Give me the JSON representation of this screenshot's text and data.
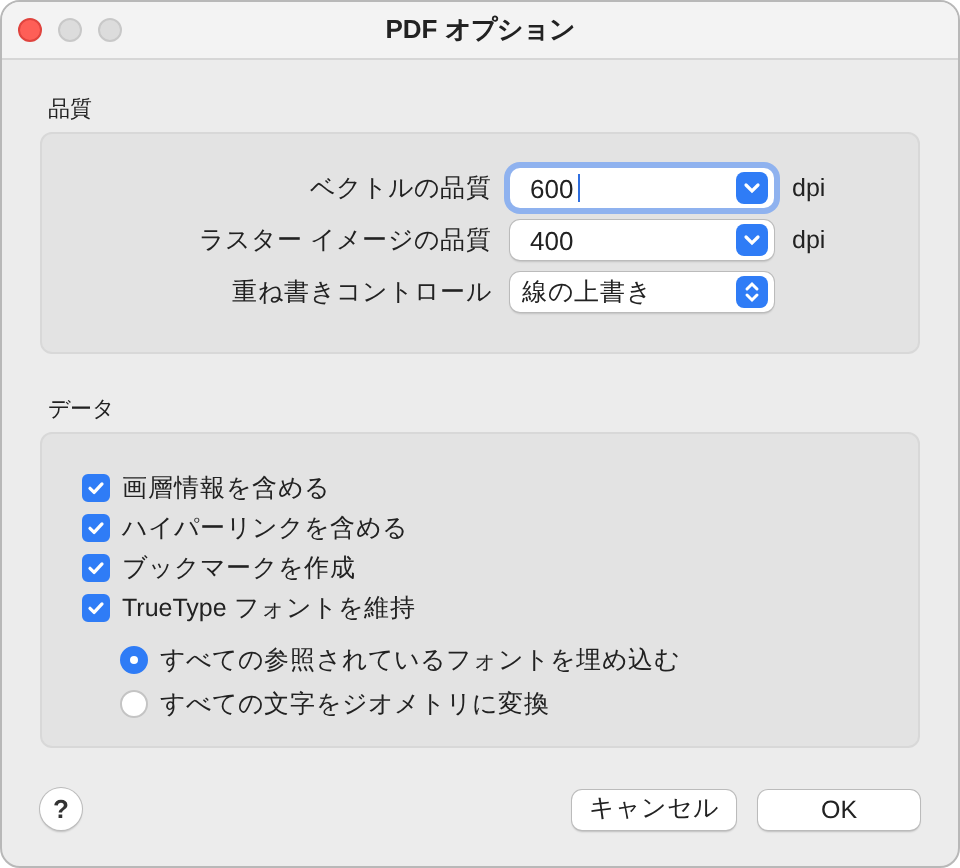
{
  "window": {
    "title": "PDF オプション"
  },
  "sections": [
    {
      "title": "品質",
      "kind": "fields",
      "fields": [
        {
          "label": "ベクトルの品質",
          "kind": "combo",
          "value": "600",
          "focused": true,
          "unit": "dpi"
        },
        {
          "label": "ラスター イメージの品質",
          "kind": "combo",
          "value": "400",
          "focused": false,
          "unit": "dpi"
        },
        {
          "label": "重ね書きコントロール",
          "kind": "popup",
          "value": "線の上書き",
          "focused": false
        }
      ]
    },
    {
      "title": "データ",
      "kind": "options",
      "checkboxes": [
        {
          "label": "画層情報を含める",
          "checked": true
        },
        {
          "label": "ハイパーリンクを含める",
          "checked": true
        },
        {
          "label": "ブックマークを作成",
          "checked": true
        },
        {
          "label": "TrueType フォントを維持",
          "checked": true
        }
      ],
      "radios": [
        {
          "label": "すべての参照されているフォントを埋め込む",
          "selected": true
        },
        {
          "label": "すべての文字をジオメトリに変換",
          "selected": false
        }
      ]
    }
  ],
  "help": {
    "label": "?"
  },
  "buttons": [
    "キャンセル",
    "OK"
  ]
}
